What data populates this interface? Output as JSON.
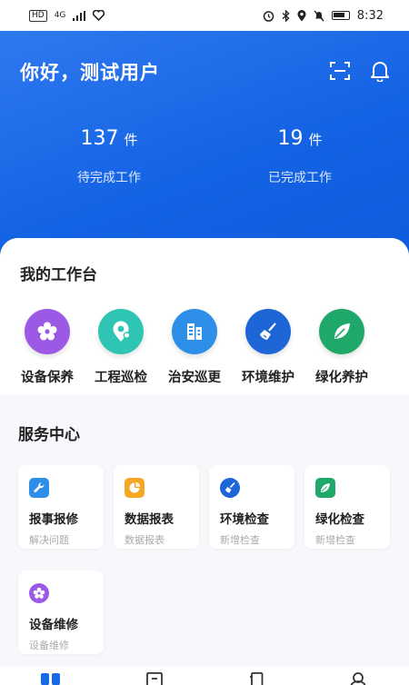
{
  "status_bar": {
    "network_badge": "HD",
    "signal_text": "4G",
    "time": "8:32"
  },
  "header": {
    "greeting": "你好，测试用户",
    "scan_icon": "scan-icon",
    "bell_icon": "bell-icon",
    "background_color": "#1769e8"
  },
  "stats": [
    {
      "value": "137",
      "unit": "件",
      "label": "待完成工作"
    },
    {
      "value": "19",
      "unit": "件",
      "label": "已完成工作"
    }
  ],
  "workbench": {
    "title": "我的工作台",
    "items": [
      {
        "label": "设备保养",
        "icon": "flower-gear-icon",
        "color": "#9b59e6"
      },
      {
        "label": "工程巡检",
        "icon": "map-pin-icon",
        "color": "#2ec5b5"
      },
      {
        "label": "治安巡更",
        "icon": "building-icon",
        "color": "#2e8fe8"
      },
      {
        "label": "环境维护",
        "icon": "broom-icon",
        "color": "#1e66d8"
      },
      {
        "label": "绿化养护",
        "icon": "leaf-icon",
        "color": "#20a86b"
      }
    ]
  },
  "service_center": {
    "title": "服务中心",
    "cards": [
      {
        "title": "报事报修",
        "subtitle": "解决问题",
        "icon": "wrench-icon",
        "color": "#2f8fe8"
      },
      {
        "title": "数据报表",
        "subtitle": "数据报表",
        "icon": "chart-icon",
        "color": "#f5a623"
      },
      {
        "title": "环境检查",
        "subtitle": "新增检查",
        "icon": "broom-icon",
        "color": "#1e66d8"
      },
      {
        "title": "绿化检查",
        "subtitle": "新增检查",
        "icon": "leaf-icon",
        "color": "#20a86b"
      },
      {
        "title": "设备维修",
        "subtitle": "设备维修",
        "icon": "gear-icon",
        "color": "#9b59e6"
      }
    ]
  },
  "tab_bar": {
    "tabs": [
      {
        "icon": "home-grid-icon",
        "active": true
      },
      {
        "icon": "document-icon",
        "active": false
      },
      {
        "icon": "phone-icon",
        "active": false
      },
      {
        "icon": "profile-icon",
        "active": false
      }
    ],
    "accent_color": "#1769e8"
  }
}
